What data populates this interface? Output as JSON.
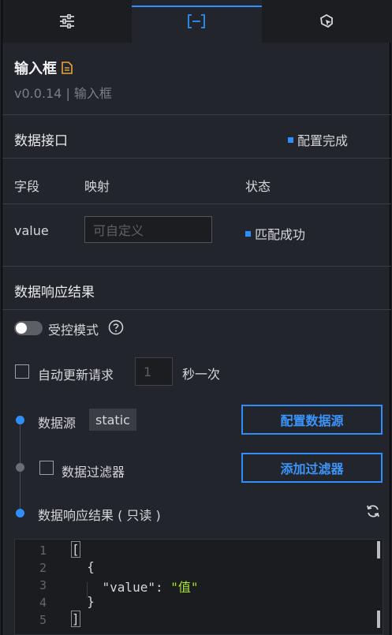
{
  "tabs": [
    {
      "name": "style",
      "icon": "sliders-icon"
    },
    {
      "name": "data",
      "icon": "data-bracket-icon"
    },
    {
      "name": "interaction",
      "icon": "interaction-icon"
    }
  ],
  "component": {
    "title": "输入框",
    "subtitle": "v0.0.14 | 输入框"
  },
  "interface": {
    "title": "数据接口",
    "status": "配置完成",
    "columns": [
      "字段",
      "映射",
      "状态"
    ],
    "row": {
      "field": "value",
      "placeholder": "可自定义",
      "status": "匹配成功"
    }
  },
  "response": {
    "title": "数据响应结果",
    "controlled_label": "受控模式",
    "auto_update_label": "自动更新请求",
    "interval_value": "1",
    "interval_unit": "秒一次",
    "source_label": "数据源",
    "source_tag": "static",
    "config_source_button": "配置数据源",
    "filter_label": "数据过滤器",
    "add_filter_button": "添加过滤器",
    "result_label": "数据响应结果 ( 只读 )"
  },
  "code": {
    "line_numbers": [
      "1",
      "2",
      "3",
      "4",
      "5"
    ],
    "lines": [
      "[",
      "  {",
      "    \"value\": ",
      "  }",
      "]"
    ],
    "value_string": "\"值\""
  },
  "colors": {
    "accent": "#2f8ef9",
    "panel_bg": "#22252b",
    "code_value": "#a6e22e"
  }
}
